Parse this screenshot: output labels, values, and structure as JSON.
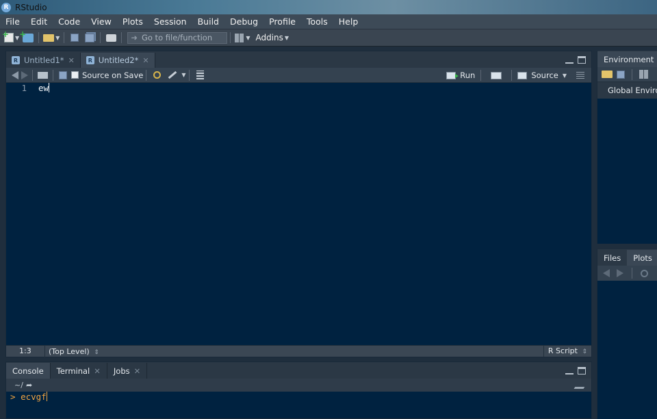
{
  "window": {
    "title": "RStudio",
    "icon_letter": "R"
  },
  "menu": [
    "File",
    "Edit",
    "Code",
    "View",
    "Plots",
    "Session",
    "Build",
    "Debug",
    "Profile",
    "Tools",
    "Help"
  ],
  "toolbar": {
    "goto_placeholder": "Go to file/function",
    "addins_label": "Addins"
  },
  "editor": {
    "tabs": [
      {
        "label": "Untitled1*",
        "active": false
      },
      {
        "label": "Untitled2*",
        "active": true
      }
    ],
    "source_on_save_label": "Source on Save",
    "run_label": "Run",
    "source_label": "Source",
    "lines": [
      {
        "number": "1",
        "text": "ew"
      }
    ],
    "status": {
      "position": "1:3",
      "scope": "(Top Level)",
      "file_type": "R Script"
    }
  },
  "console": {
    "tabs": [
      "Console",
      "Terminal",
      "Jobs"
    ],
    "path": "~/",
    "prompt": ">",
    "input": "ecvgf"
  },
  "right_top": {
    "tabs": [
      "Environment"
    ],
    "scope_label": "Global Enviro"
  },
  "right_bottom": {
    "tabs": [
      "Files",
      "Plots"
    ]
  }
}
